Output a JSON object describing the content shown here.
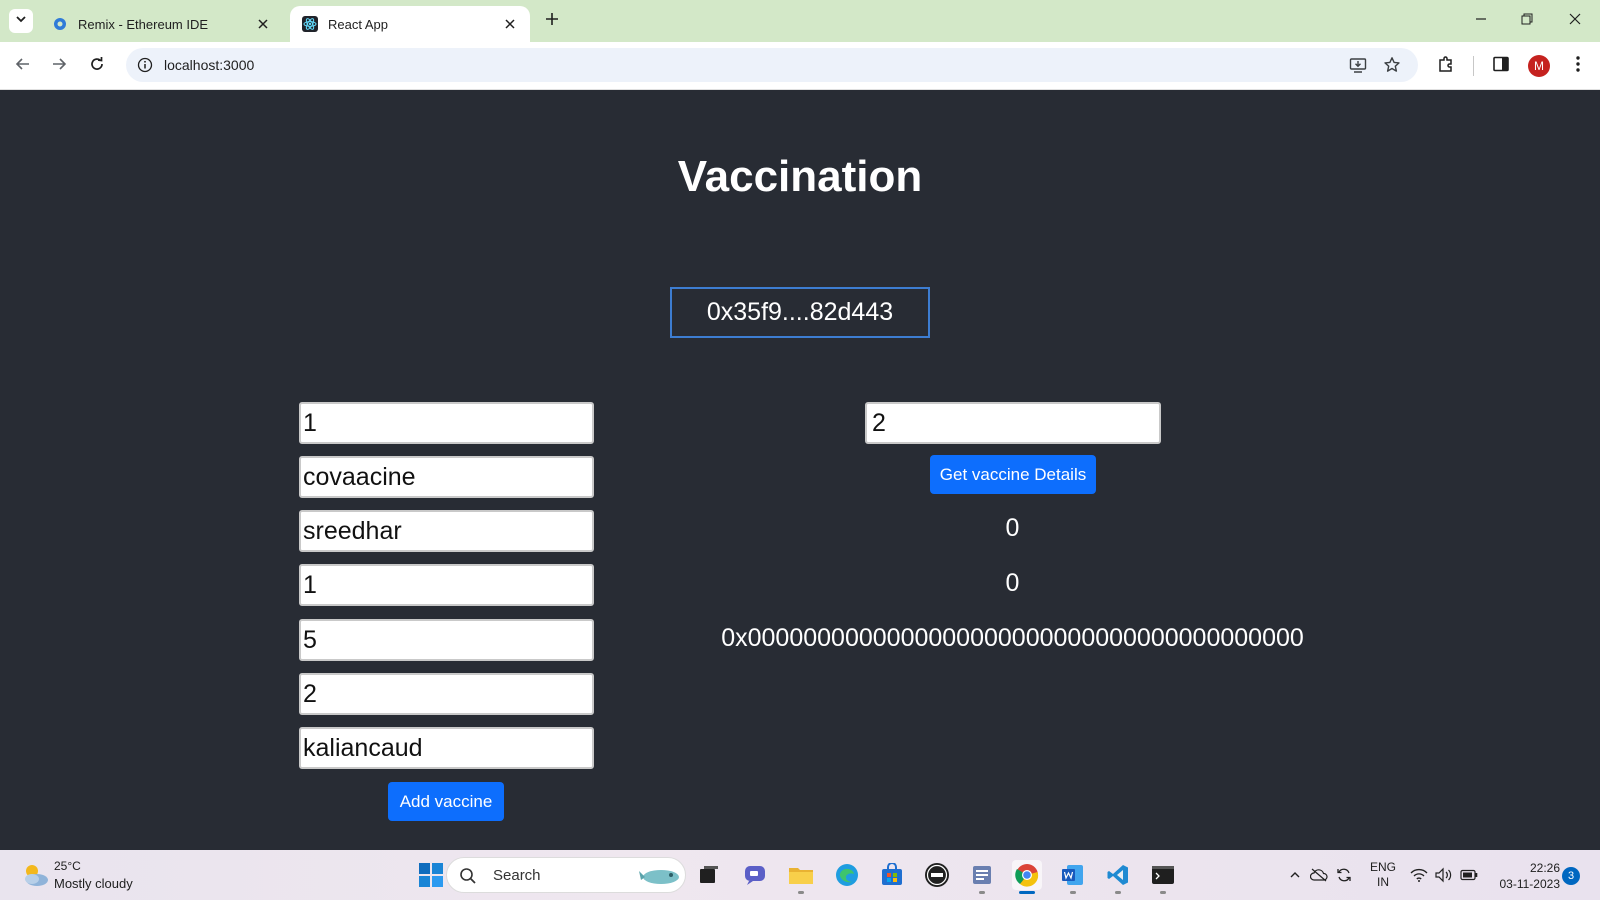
{
  "browser": {
    "tabs": [
      {
        "title": "Remix - Ethereum IDE",
        "active": false
      },
      {
        "title": "React App",
        "active": true
      }
    ],
    "url": "localhost:3000",
    "profile_initial": "M"
  },
  "app": {
    "title": "Vaccination",
    "account": "0x35f9....82d443",
    "add_form": {
      "fields": [
        "1",
        "covaacine",
        "sreedhar",
        "1",
        "5",
        "2",
        "kaliancaud"
      ],
      "submit_label": "Add vaccine"
    },
    "lookup": {
      "input_value": "2",
      "button_label": "Get vaccine Details",
      "results": [
        "0",
        "0",
        "0x0000000000000000000000000000000000000000"
      ]
    }
  },
  "taskbar": {
    "weather_temp": "25°C",
    "weather_desc": "Mostly cloudy",
    "search_placeholder": "Search",
    "lang_line1": "ENG",
    "lang_line2": "IN",
    "time": "22:26",
    "date": "03-11-2023",
    "notification_count": "3"
  },
  "colors": {
    "page_bg": "#282c34",
    "primary_button": "#0d6efd",
    "tabbar_bg": "#d3e8c8",
    "account_border": "#3d7dd1"
  }
}
